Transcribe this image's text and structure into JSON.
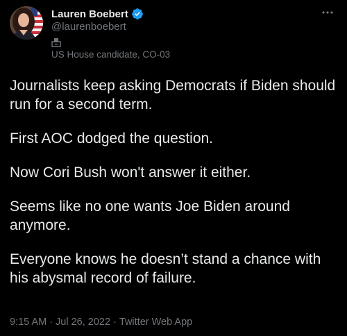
{
  "author": {
    "display_name": "Lauren Boebert",
    "handle": "@laurenboebert",
    "label": "US House candidate, CO-03",
    "verified_icon": "verified-badge-icon",
    "label_icon": "ballot-box-icon"
  },
  "tweet": {
    "paragraphs": [
      "Journalists keep asking Democrats if Biden should run for a second term.",
      "First AOC dodged the question.",
      "Now Cori Bush won't answer it either.",
      "Seems like no one wants Joe Biden around anymore.",
      "Everyone knows he doesn’t stand a chance with his abysmal record of failure."
    ],
    "time": "9:15 AM",
    "separator": "·",
    "date": "Jul 26, 2022",
    "source": "Twitter Web App"
  },
  "menu": {
    "more_icon": "more-horizontal-icon"
  },
  "colors": {
    "background": "#000000",
    "text_primary": "#e7e9ea",
    "text_secondary": "#71767b",
    "verified_blue": "#1d9bf0"
  }
}
